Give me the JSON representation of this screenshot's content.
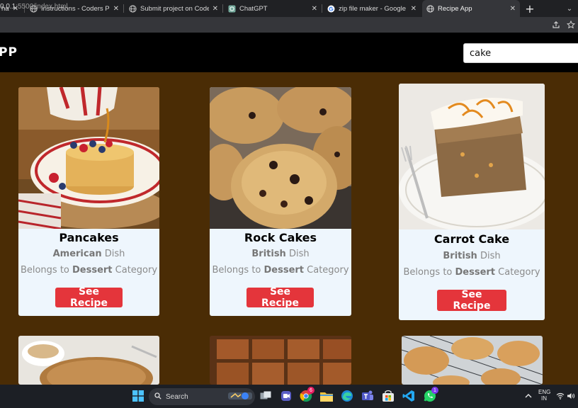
{
  "browser": {
    "tabs": [
      {
        "title": "has",
        "close": "✕",
        "icon": "page-icon"
      },
      {
        "title": "Instructions - Coders Packet",
        "close": "✕",
        "icon": "globe-icon"
      },
      {
        "title": "Submit project on Coders Pa",
        "close": "✕",
        "icon": "globe-icon"
      },
      {
        "title": "ChatGPT",
        "close": "✕",
        "icon": "chatgpt-icon"
      },
      {
        "title": "zip file maker - Google Sear",
        "close": "✕",
        "icon": "google-icon"
      },
      {
        "title": "Recipe App",
        "close": "✕",
        "icon": "globe-icon"
      }
    ],
    "new_tab": "+",
    "tab_menu": "⌄",
    "url_host": "0.0.1",
    "url_rest": ":5500/index.html"
  },
  "app": {
    "title": "PP",
    "search_value": "cake"
  },
  "recipes": [
    {
      "name": "Pancakes",
      "area": "American",
      "dish_word": " Dish",
      "belongs": "Belongs to ",
      "category": "Dessert",
      "category_word": " Category",
      "button": "See Recipe"
    },
    {
      "name": "Rock Cakes",
      "area": "British",
      "dish_word": " Dish",
      "belongs": "Belongs to ",
      "category": "Dessert",
      "category_word": " Category",
      "button": "See Recipe"
    },
    {
      "name": "Carrot Cake",
      "area": "British",
      "dish_word": " Dish",
      "belongs": "Belongs to ",
      "category": "Dessert",
      "category_word": " Category",
      "button": "See Recipe"
    }
  ],
  "taskbar": {
    "search_label": "Search",
    "lang_line1": "ENG",
    "lang_line2": "IN",
    "chrome_badge": "6",
    "whatsapp_badge": "1"
  },
  "colors": {
    "page_bg": "#4a2c05",
    "header_bg": "#000000",
    "card_bg": "#eef6fd",
    "button_bg": "#e4353b"
  }
}
